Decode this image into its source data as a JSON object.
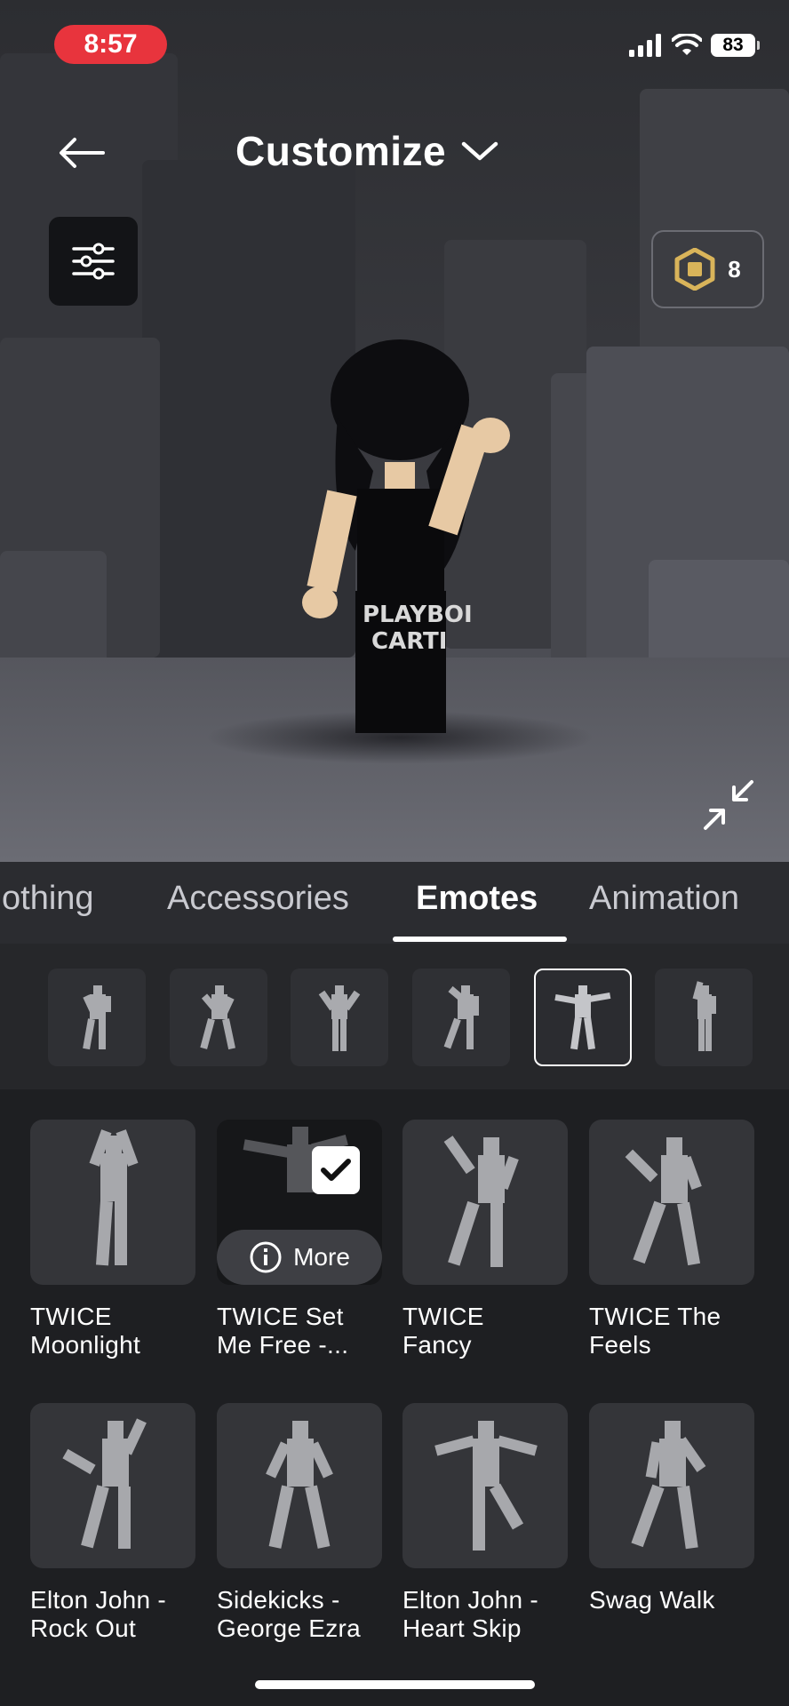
{
  "status_bar": {
    "time": "8:57",
    "battery": "83"
  },
  "header": {
    "title": "Customize"
  },
  "robux": {
    "count": "8"
  },
  "tabs": [
    {
      "label": "Clothing",
      "visible_text": "othing"
    },
    {
      "label": "Accessories"
    },
    {
      "label": "Emotes",
      "active": true
    },
    {
      "label": "Animation"
    }
  ],
  "emote_slots": {
    "count_visible": 6,
    "selected_index": 4
  },
  "emotes": [
    {
      "label": "TWICE\nMoonlight"
    },
    {
      "label": "TWICE Set\nMe Free -...",
      "equipped": true,
      "more_label": "More"
    },
    {
      "label": "TWICE\nFancy"
    },
    {
      "label": "TWICE The\nFeels"
    },
    {
      "label": "Elton John -\nRock Out"
    },
    {
      "label": "Sidekicks -\nGeorge Ezra"
    },
    {
      "label": "Elton John -\nHeart Skip"
    },
    {
      "label": "Swag Walk"
    }
  ],
  "avatar_shirt_text": "PLAYBOI CARTI",
  "colors": {
    "status_red": "#e8343d",
    "grid_bg": "#1e1f22",
    "tab_bg": "#2b2c30",
    "robux_gold": "#d9b45a"
  }
}
